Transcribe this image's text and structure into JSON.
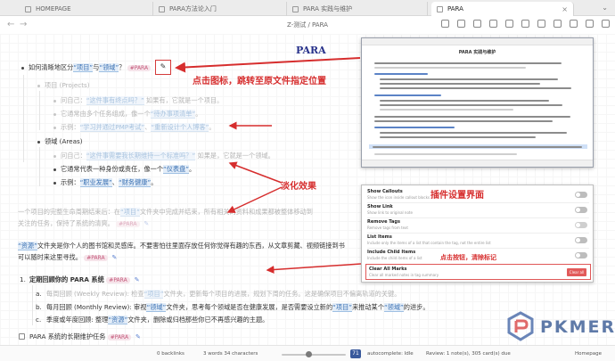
{
  "tabs": [
    {
      "label": "HOMEPAGE"
    },
    {
      "label": "PARA方法论入门"
    },
    {
      "label": "PARA 实践与维护"
    },
    {
      "label": "PARA"
    }
  ],
  "toolbar": {
    "path": "Z-测试 / PARA"
  },
  "editor": {
    "l1": {
      "pre": "如何清晰地区分",
      "link1": "“项目”",
      "mid": "与",
      "link2": "“领域”",
      "post": "？",
      "tag": "#PARA"
    },
    "l2": {
      "text": "项目 (Projects)"
    },
    "l3": {
      "pre": "问自己：",
      "link": "“这件事有终点吗？”",
      "post": " 如果有，它就是一个项目。"
    },
    "l4": {
      "text": "它通常由多个任务组成，像一个",
      "link": "“待办事项清单”",
      "post": "。"
    },
    "l5": {
      "pre": "示例：",
      "link1": "“学习并通过PMP考试”",
      "mid": "、",
      "link2": "“重新设计个人博客”",
      "post": "。"
    },
    "l6": {
      "text": "领域 (Areas)"
    },
    "l7": {
      "pre": "问自己：",
      "link": "“这件事需要我长期维持一个标准吗？”",
      "post": " 如果是，它就是一个领域。"
    },
    "l8": {
      "pre": "它通常代表一种身份或责任，像一个",
      "link": "“仪表盘”",
      "post": "。"
    },
    "l9": {
      "pre": "示例：",
      "link1": "“职业发展”",
      "mid": "、",
      "link2": "“财务健康”",
      "post": "。"
    },
    "p1a": {
      "pre": "一个项目的完整生命周期结束后：在",
      "link": "“项目”",
      "post": "文件夹中完成并结束，所有相关的资料和成果都被整体移动到"
    },
    "p1b": {
      "pre": "关注的任务，保持了系统的清爽。",
      "tag": "#PARA"
    },
    "p2a": {
      "link": "“资源”",
      "post": "文件夹是你个人的图书馆和灵感库。不要害怕往里面存放任何你觉得有趣的东西，从文章剪藏、视频链接到书"
    },
    "p2b": {
      "pre": "可以随时来这里寻找。",
      "tag": "#PARA"
    },
    "o1": {
      "num": "1.",
      "text": "定期回顾你的 PARA 系统",
      "tag": "#PARA"
    },
    "o2": {
      "pre": "每周回顾 (Weekly Review): 检查",
      "link1": "“项目”",
      "mid": "文件夹，更新每个项目的进展，规划下周的任务。这是确保项目不偏离轨道的关键。"
    },
    "o3": {
      "pre": "每月回顾 (Monthly Review): 审视",
      "link1": "“领域”",
      "mid": "文件夹，思考每个领域是否在健康发展，是否需要设立新的",
      "link2": "“项目”",
      "post": "来推动某个",
      "link3": "“领域”",
      "end": "的进步。"
    },
    "o4": {
      "pre": "季度或年度回顾: 整理",
      "link1": "“资源”",
      "post": "文件夹，删除或归档那些你已不再感兴趣的主题。"
    },
    "t1": {
      "text": "PARA 系统的长期维护任务",
      "tag": "#PARA"
    },
    "o_letters": [
      "a.",
      "b.",
      "c."
    ]
  },
  "annotations": {
    "title": "PARA",
    "jump": "点击图标，跳转至原文件指定位置",
    "fade": "淡化效果",
    "settings": "插件设置界面",
    "clear": "点击按钮，清除标记"
  },
  "preview": {
    "title": "PARA 实践与维护"
  },
  "settings": {
    "rows": [
      {
        "name": "Show Callouts",
        "desc": "Show the icon inside callout blocks"
      },
      {
        "name": "Show Link",
        "desc": "Show link to original note"
      },
      {
        "name": "Remove Tags",
        "desc": "Remove tags from text"
      },
      {
        "name": "List Items",
        "desc": "Include only the items of a list that contain the tag, not the entire list"
      },
      {
        "name": "Include Child Items",
        "desc": "Include the child items of a list"
      }
    ],
    "clear": {
      "name": "Clear All Marks",
      "desc": "Clear all marked notes in tag summary",
      "button": "Clear all"
    }
  },
  "statusbar": {
    "backlinks": "0 backlinks",
    "counts": "3 words  34 characters",
    "zoom": "71",
    "autocomplete": "autocomplete: Idle",
    "review": "Review: 1 note(s), 305 card(s) due",
    "homepage": "Homepage"
  },
  "logo": {
    "text": "PKMER"
  },
  "colors": {
    "accent_red": "#d62d2d",
    "link_blue": "#3c72b4",
    "tag_pink": "#c3587a"
  }
}
